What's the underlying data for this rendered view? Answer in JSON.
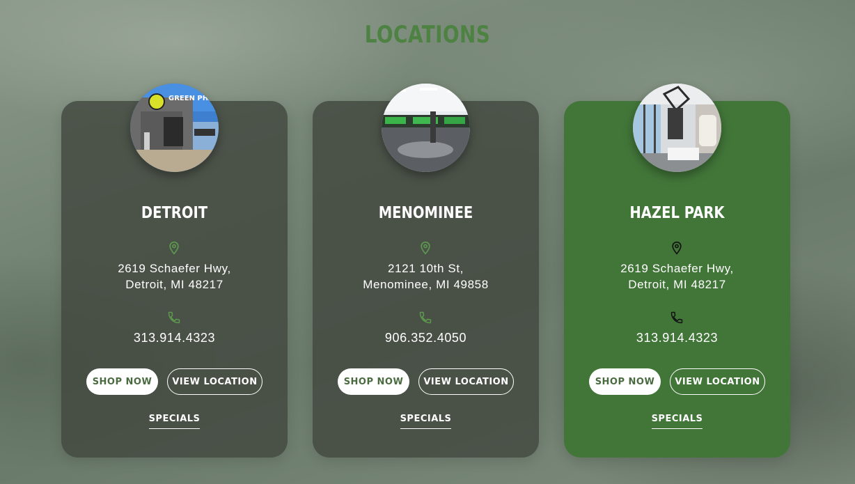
{
  "page": {
    "title": "LOCATIONS"
  },
  "colors": {
    "accent_green": "#4e8242",
    "active_card": "#427639",
    "card_bg": "#42483f",
    "icon_green": "#5d9a4e"
  },
  "locations": [
    {
      "name": "DETROIT",
      "address_line1": "2619 Schaefer Hwy,",
      "address_line2": "Detroit, MI 48217",
      "phone": "313.914.4323",
      "shop_label": "SHOP NOW",
      "view_label": "VIEW LOCATION",
      "specials_label": "SPECIALS",
      "photo_sign": "GREEN PHARM",
      "active": false
    },
    {
      "name": "MENOMINEE",
      "address_line1": "2121 10th St,",
      "address_line2": "Menominee, MI 49858",
      "phone": "906.352.4050",
      "shop_label": "SHOP NOW",
      "view_label": "VIEW LOCATION",
      "specials_label": "SPECIALS",
      "active": false
    },
    {
      "name": "HAZEL PARK",
      "address_line1": "2619 Schaefer Hwy,",
      "address_line2": "Detroit, MI 48217",
      "phone": "313.914.4323",
      "shop_label": "SHOP NOW",
      "view_label": "VIEW LOCATION",
      "specials_label": "SPECIALS",
      "active": true
    }
  ]
}
